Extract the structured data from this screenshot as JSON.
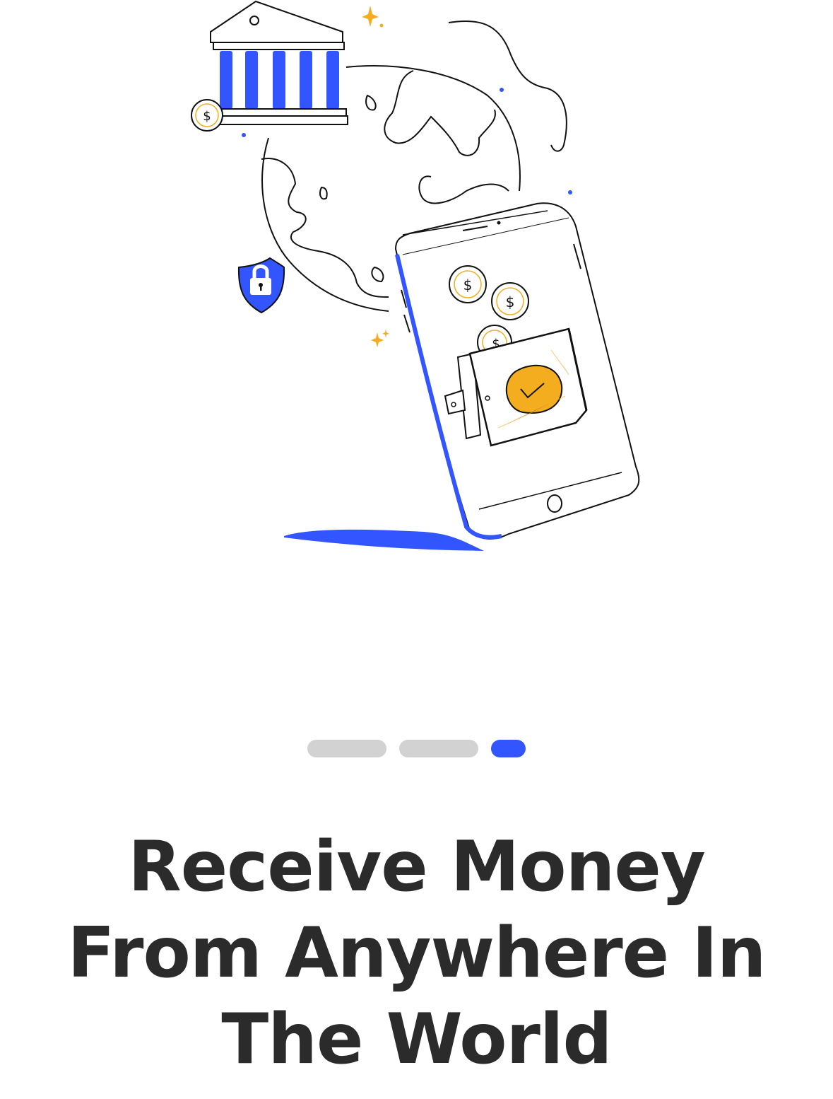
{
  "colors": {
    "accent": "#3355ff",
    "coin_gold": "#f4ad1e",
    "ink": "#111111",
    "text": "#2b2b2b",
    "dot_inactive": "#d2d2d2"
  },
  "illustration": {
    "icons": [
      "bank-icon",
      "globe-icon",
      "phone-icon",
      "wallet-icon",
      "coin-icon",
      "lock-shield-icon",
      "sparkle-icon"
    ],
    "coin_symbol": "$"
  },
  "pager": {
    "total": 3,
    "current": 3
  },
  "headline": {
    "line1": "Receive Money",
    "line2": "From Anywhere In",
    "line3": "The World"
  }
}
